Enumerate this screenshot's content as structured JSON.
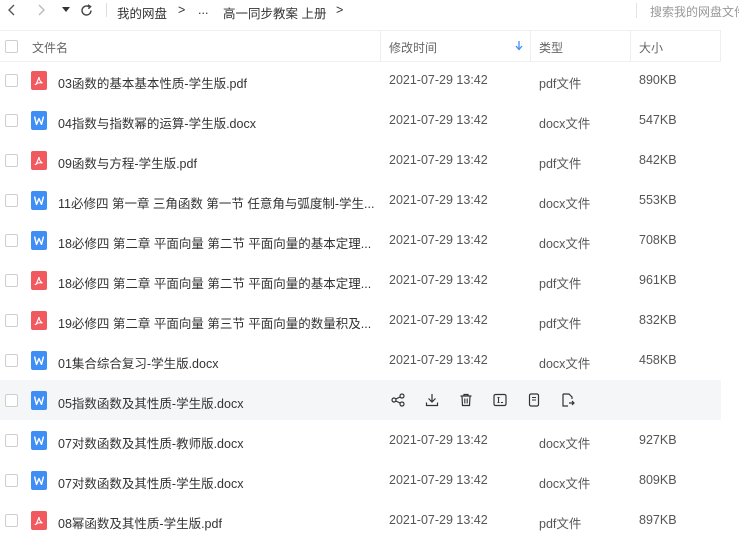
{
  "breadcrumb": {
    "root": "我的网盘",
    "ellipsis": "...",
    "current": "高一同步教案 上册",
    "sep1": ">",
    "sep2": ">",
    "sep3": ">"
  },
  "search": {
    "placeholder": "搜索我的网盘文件"
  },
  "columns": {
    "name": "文件名",
    "modified": "修改时间",
    "type": "类型",
    "size": "大小"
  },
  "files": [
    {
      "name": "03函数的基本基本性质-学生版.pdf",
      "icon": "pdf-icon",
      "time": "2021-07-29 13:42",
      "type": "pdf文件",
      "size": "890KB"
    },
    {
      "name": "04指数与指数幂的运算-学生版.docx",
      "icon": "word-icon",
      "time": "2021-07-29 13:42",
      "type": "docx文件",
      "size": "547KB"
    },
    {
      "name": "09函数与方程-学生版.pdf",
      "icon": "pdf-icon",
      "time": "2021-07-29 13:42",
      "type": "pdf文件",
      "size": "842KB"
    },
    {
      "name": "11必修四 第一章 三角函数 第一节 任意角与弧度制-学生...",
      "icon": "word-icon",
      "time": "2021-07-29 13:42",
      "type": "docx文件",
      "size": "553KB"
    },
    {
      "name": "18必修四 第二章 平面向量 第二节 平面向量的基本定理...",
      "icon": "word-icon",
      "time": "2021-07-29 13:42",
      "type": "docx文件",
      "size": "708KB"
    },
    {
      "name": "18必修四 第二章 平面向量 第二节 平面向量的基本定理...",
      "icon": "pdf-icon",
      "time": "2021-07-29 13:42",
      "type": "pdf文件",
      "size": "961KB"
    },
    {
      "name": "19必修四 第二章 平面向量 第三节 平面向量的数量积及...",
      "icon": "pdf-icon",
      "time": "2021-07-29 13:42",
      "type": "pdf文件",
      "size": "832KB"
    },
    {
      "name": "01集合综合复习-学生版.docx",
      "icon": "word-icon",
      "time": "2021-07-29 13:42",
      "type": "docx文件",
      "size": "458KB"
    },
    {
      "name": "05指数函数及其性质-学生版.docx",
      "icon": "word-icon",
      "time": "",
      "type": "",
      "size": "",
      "hover": true
    },
    {
      "name": "07对数函数及其性质-教师版.docx",
      "icon": "word-icon",
      "time": "2021-07-29 13:42",
      "type": "docx文件",
      "size": "927KB"
    },
    {
      "name": "07对数函数及其性质-学生版.docx",
      "icon": "word-icon",
      "time": "2021-07-29 13:42",
      "type": "docx文件",
      "size": "809KB"
    },
    {
      "name": "08幂函数及其性质-学生版.pdf",
      "icon": "pdf-icon",
      "time": "2021-07-29 13:42",
      "type": "pdf文件",
      "size": "897KB"
    }
  ],
  "hover_actions": [
    "share-icon",
    "download-icon",
    "delete-icon",
    "rename-icon",
    "copy-icon",
    "move-icon"
  ],
  "colors": {
    "pdf": "#f05a5f",
    "word": "#3f8ef5",
    "sort_arrow": "#3f8ef5",
    "hover_row": "#f5f6f8"
  }
}
